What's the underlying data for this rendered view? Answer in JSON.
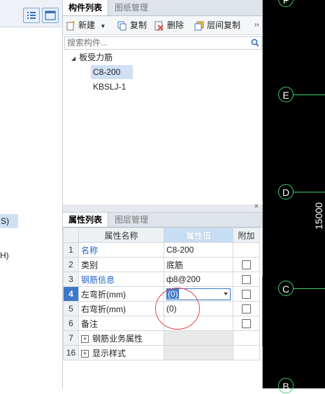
{
  "left_strip": {
    "cut_labels": [
      "S)",
      "H)"
    ]
  },
  "component_panel": {
    "tabs": [
      {
        "label": "构件列表",
        "active": true
      },
      {
        "label": "图纸管理",
        "active": false
      }
    ],
    "toolbar": {
      "new_label": "新建",
      "copy_label": "复制",
      "delete_label": "删除",
      "floor_copy_label": "层间复制",
      "more_label": "››"
    },
    "search": {
      "placeholder": "搜索构件..."
    },
    "tree": {
      "root": "板受力筋",
      "children": [
        "C8-200",
        "KBSLJ-1"
      ],
      "selected": "C8-200"
    }
  },
  "props_panel": {
    "tabs": [
      {
        "label": "属性列表",
        "active": true
      },
      {
        "label": "图层管理",
        "active": false
      }
    ],
    "close_icon": "×",
    "headers": [
      "属性名称",
      "属性值",
      "附加"
    ],
    "rows": [
      {
        "num": "1",
        "name": "名称",
        "value": "C8-200",
        "checkbox": false,
        "name_blue": true
      },
      {
        "num": "2",
        "name": "类别",
        "value": "底筋",
        "checkbox": true
      },
      {
        "num": "3",
        "name": "钢筋信息",
        "value": "ф8@200",
        "checkbox": true,
        "name_blue": true
      },
      {
        "num": "4",
        "name": "左弯折(mm)",
        "value": "(0)",
        "checkbox": true,
        "selected": true
      },
      {
        "num": "5",
        "name": "右弯折(mm)",
        "value": "(0)",
        "checkbox": true
      },
      {
        "num": "6",
        "name": "备注",
        "value": "",
        "checkbox": true
      },
      {
        "num": "7",
        "name": "钢筋业务属性",
        "value": "",
        "expandable": true
      },
      {
        "num": "16",
        "name": "显示样式",
        "value": "",
        "expandable": true
      }
    ]
  },
  "canvas": {
    "axis_labels": [
      "F",
      "E",
      "D",
      "C",
      "B"
    ],
    "dimension_text": "15000",
    "colors": {
      "background": "#000000",
      "axis": "#37d36b"
    }
  }
}
